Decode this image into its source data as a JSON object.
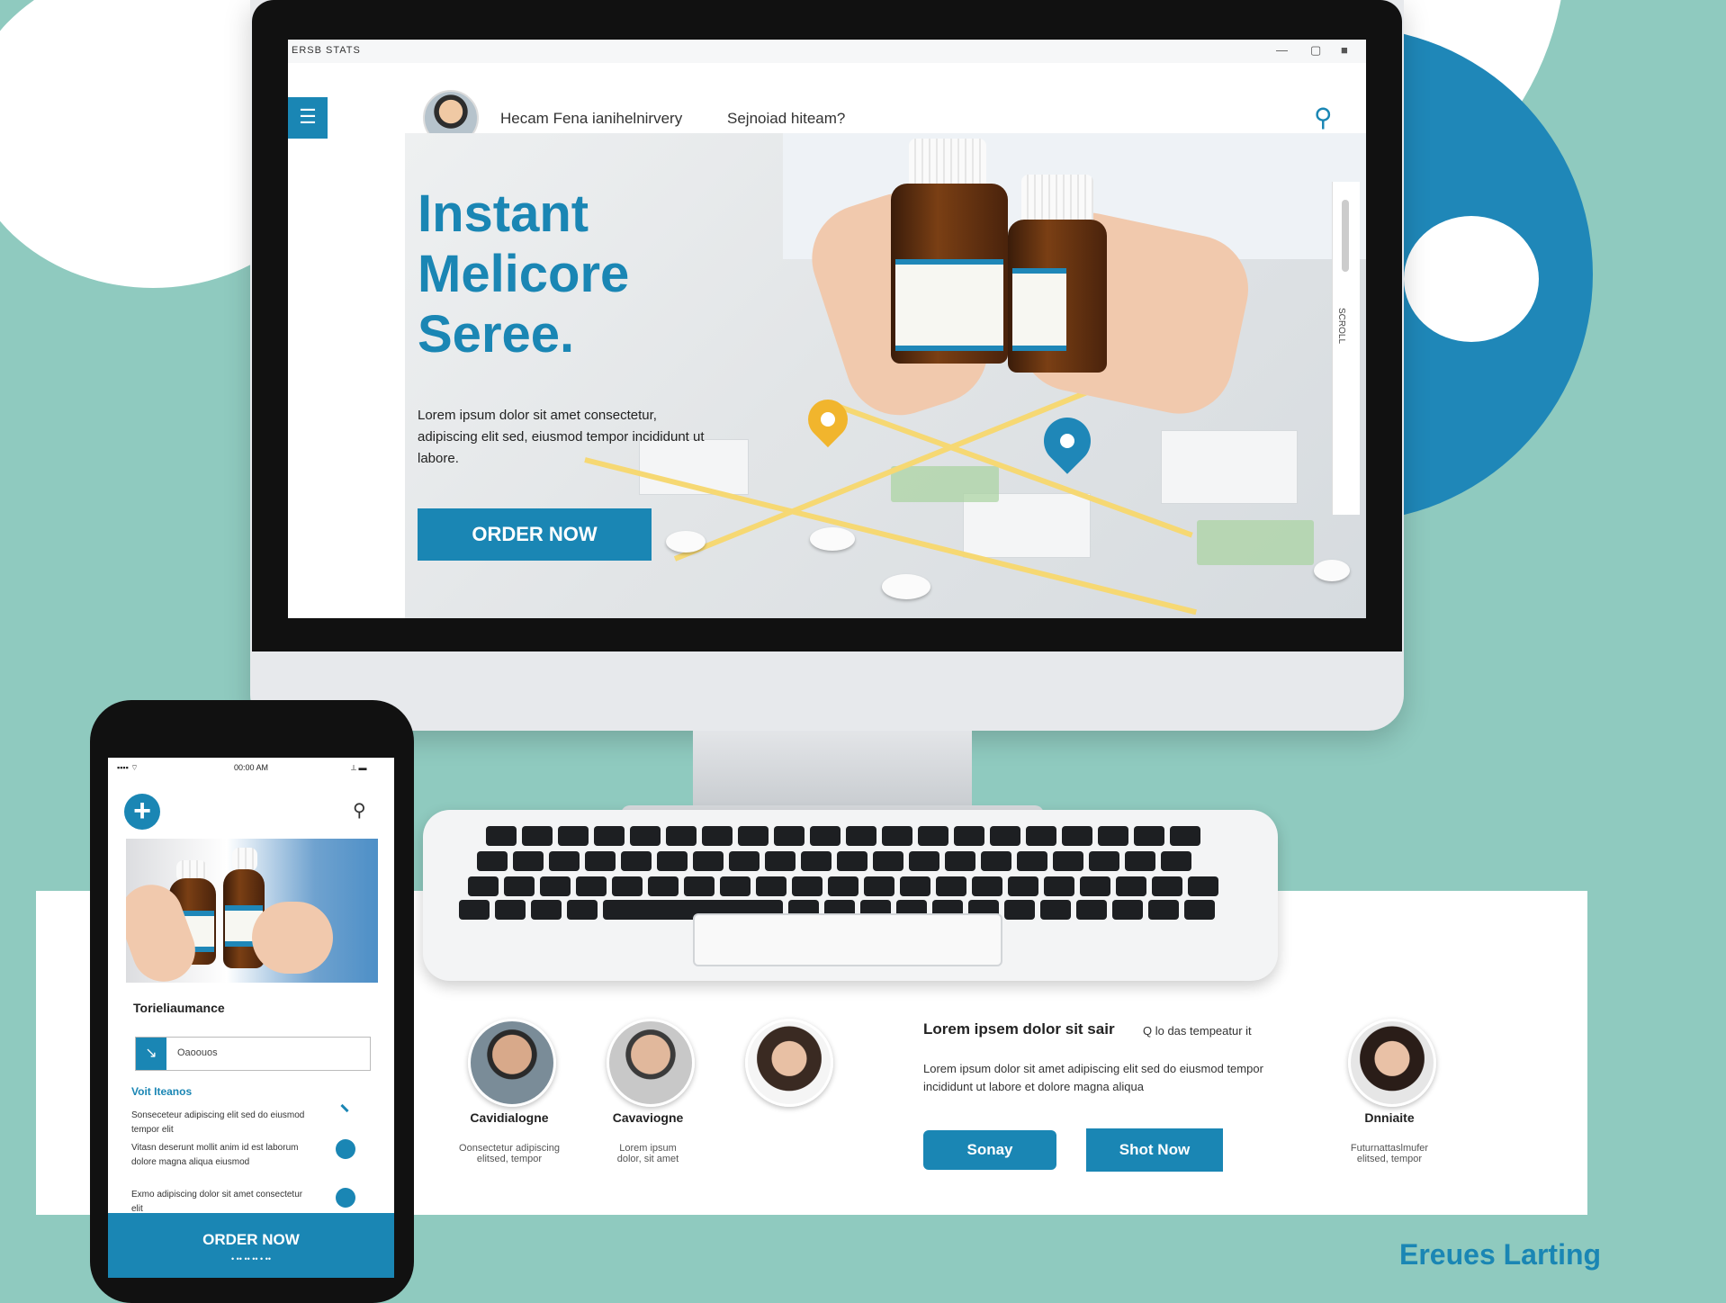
{
  "desktop": {
    "titlebar": {
      "brand": "ERSB STATS",
      "minimize": "—",
      "maximize": "▢",
      "close": "■"
    },
    "nav": {
      "menu_icon": "☰",
      "links": [
        "Hecam Fena ianihelnirvery",
        "Sejnoiad hiteam?"
      ],
      "search_icon": "⚲"
    },
    "hero": {
      "title_lines": [
        "Instant",
        "Melicore",
        "Seree."
      ],
      "description": "Lorem ipsum dolor sit amet consectetur, adipiscing elit sed, eiusmod tempor incididunt ut labore.",
      "order_button": "ORDER NOW",
      "scroll_label": "SCROLL"
    }
  },
  "bottom": {
    "people": [
      {
        "name": "Cavidialogne",
        "subtitle": "Oonsectetur adipiscing\nelitsed, tempor"
      },
      {
        "name": "Cavaviogne",
        "subtitle": "Lorem ipsum\ndolor, sit amet"
      },
      {
        "name": "",
        "subtitle": ""
      },
      {
        "name": "Dnniaite",
        "subtitle": "Futurnattaslmufer\nelitsed, tempor"
      }
    ],
    "promo": {
      "title": "Lorem ipsem dolor sit sair",
      "note": "Q lo das tempeatur it",
      "description": "Lorem ipsum dolor sit amet adipiscing elit sed do eiusmod tempor incididunt ut labore et dolore magna aliqua",
      "button_primary": "Sonay",
      "button_secondary": "Shot Now"
    },
    "brand": "Ereues Larting"
  },
  "phone": {
    "status": {
      "left": "▪▪▪▪  ⌔",
      "center": "00:00 AM",
      "right": "⟂  ▬"
    },
    "plus_icon": "+",
    "search_icon": "⚲",
    "heading": "Torieliaumance",
    "input_icon": "↘",
    "input_text": "Oaoouos",
    "subheading": "Voit Iteanos",
    "items": [
      "Sonseceteur adipiscing elit sed do eiusmod tempor elit",
      "Vitasn deserunt mollit anim id est laborum dolore magna aliqua eiusmod",
      "Exmo adipiscing dolor sit amet consectetur elit"
    ],
    "order_button": "ORDER NOW",
    "order_dots": "•  ••  ••  ••  •  ••"
  },
  "colors": {
    "accent": "#1a86b4",
    "background": "#8fcabf",
    "pin_yellow": "#f1b52d"
  }
}
